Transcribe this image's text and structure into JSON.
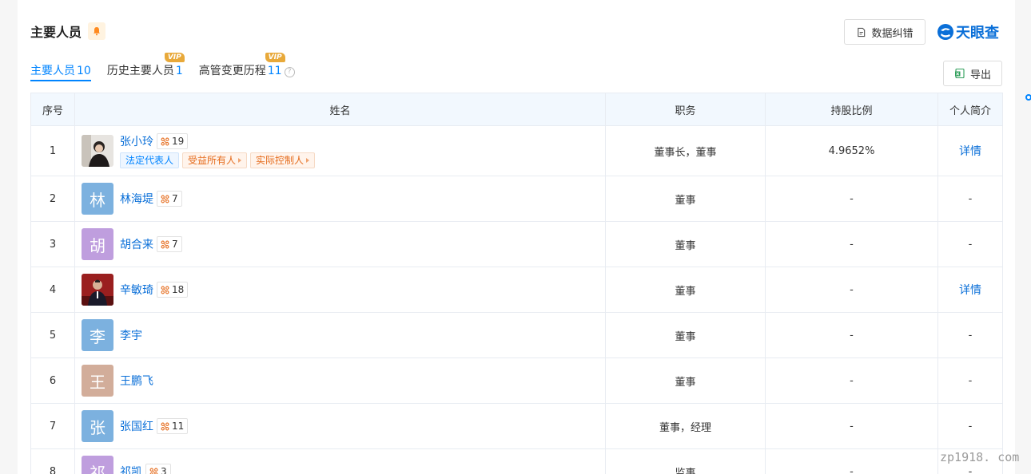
{
  "section": {
    "title": "主要人员",
    "correct_label": "数据纠错",
    "logo_text": "天眼查",
    "export_label": "导出"
  },
  "tabs": [
    {
      "label": "主要人员",
      "count": "10",
      "active": true,
      "vip": ""
    },
    {
      "label": "历史主要人员",
      "count": "1",
      "active": false,
      "vip": "VIP"
    },
    {
      "label": "高管变更历程",
      "count": "11",
      "active": false,
      "vip": "VIP"
    }
  ],
  "table": {
    "headers": [
      "序号",
      "姓名",
      "职务",
      "持股比例",
      "个人简介"
    ],
    "rows": [
      {
        "idx": "1",
        "name": "张小玲",
        "avatar_char": "",
        "avatar_color": "",
        "relation_count": "19",
        "tags": [
          "法定代表人",
          "受益所有人",
          "实际控制人"
        ],
        "position": "董事长，董事",
        "share": "4.9652%",
        "profile": "详情"
      },
      {
        "idx": "2",
        "name": "林海堤",
        "avatar_char": "林",
        "avatar_color": "#7cb1df",
        "relation_count": "7",
        "tags": [],
        "position": "董事",
        "share": "-",
        "profile": "-"
      },
      {
        "idx": "3",
        "name": "胡合来",
        "avatar_char": "胡",
        "avatar_color": "#bf9ede",
        "relation_count": "7",
        "tags": [],
        "position": "董事",
        "share": "-",
        "profile": "-"
      },
      {
        "idx": "4",
        "name": "辛敏琦",
        "avatar_char": "",
        "avatar_color": "",
        "relation_count": "18",
        "tags": [],
        "position": "董事",
        "share": "-",
        "profile": "详情"
      },
      {
        "idx": "5",
        "name": "李宇",
        "avatar_char": "李",
        "avatar_color": "#7cb1df",
        "relation_count": "",
        "tags": [],
        "position": "董事",
        "share": "-",
        "profile": "-"
      },
      {
        "idx": "6",
        "name": "王鹏飞",
        "avatar_char": "王",
        "avatar_color": "#d2ad9a",
        "relation_count": "",
        "tags": [],
        "position": "董事",
        "share": "-",
        "profile": "-"
      },
      {
        "idx": "7",
        "name": "张国红",
        "avatar_char": "张",
        "avatar_color": "#7cb1df",
        "relation_count": "11",
        "tags": [],
        "position": "董事，经理",
        "share": "-",
        "profile": "-"
      },
      {
        "idx": "8",
        "name": "祁凯",
        "avatar_char": "祁",
        "avatar_color": "#bf9ede",
        "relation_count": "3",
        "tags": [],
        "position": "监事",
        "share": "-",
        "profile": "-"
      }
    ]
  },
  "watermark": "zp1918. com",
  "colors": {
    "accent": "#0084ff",
    "link": "#0a6fd8",
    "vip": "#e8a93a",
    "header_bg": "#f2f8fe"
  }
}
